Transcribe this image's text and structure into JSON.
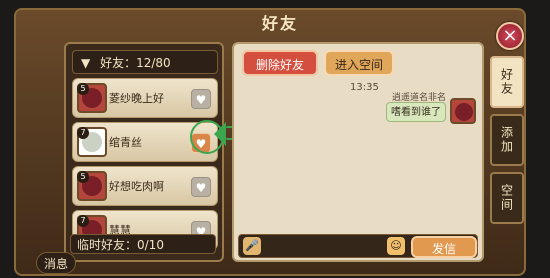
{
  "window": {
    "title": "好友"
  },
  "friends": {
    "header": "好友：12/80",
    "items": [
      {
        "level": "5",
        "name": "菱纱晚上好",
        "heart_active": false
      },
      {
        "level": "7",
        "name": "绾青丝",
        "heart_active": true
      },
      {
        "level": "5",
        "name": "好想吃肉啊",
        "heart_active": false
      },
      {
        "level": "7",
        "name": "慧慧",
        "heart_active": false
      }
    ],
    "temp": "临时好友：0/10"
  },
  "actions": {
    "delete": "删除好友",
    "space": "进入空间"
  },
  "chat": {
    "timestamp": "13:35",
    "sender_name": "逍遥道名非名",
    "message": "嗜看到谁了"
  },
  "input": {
    "send": "发信"
  },
  "side_tabs": [
    "好友",
    "添加",
    "空间"
  ],
  "messages_tab": "消息",
  "icons": {
    "close": "×",
    "mic": "🎤",
    "emoji": "☺",
    "heart": "♥",
    "arrow": "▼"
  }
}
